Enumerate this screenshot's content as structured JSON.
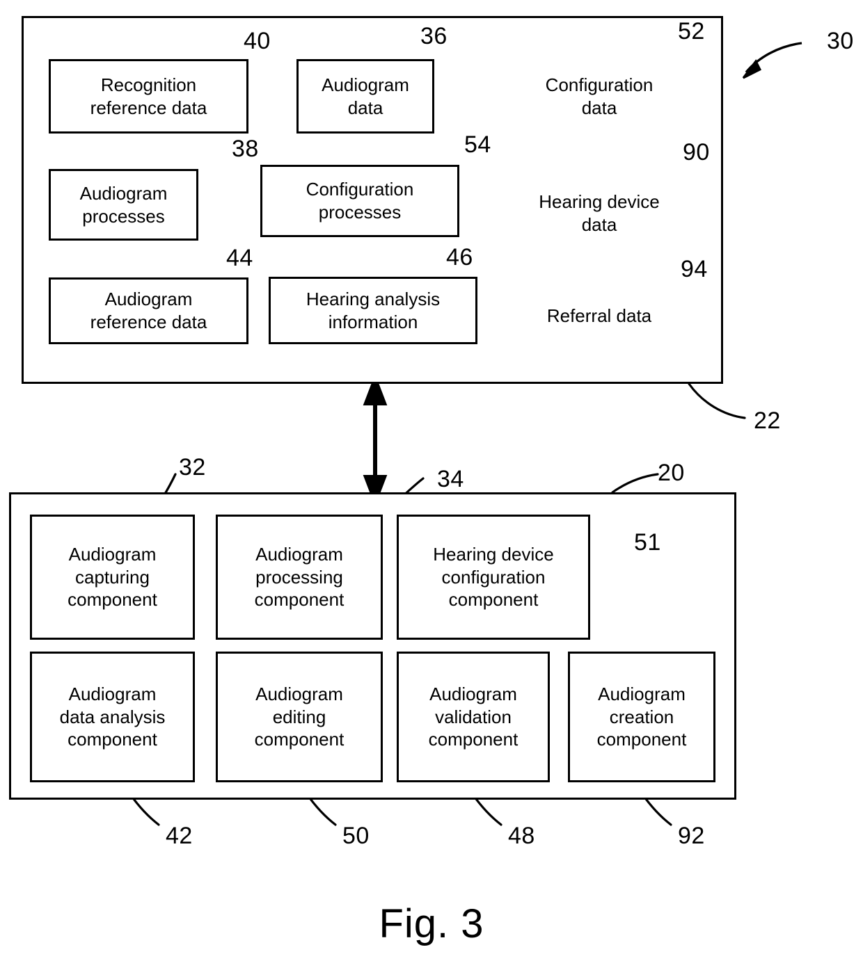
{
  "figure": {
    "caption": "Fig. 3",
    "containers": [
      {
        "id": "box-22",
        "ref": "22",
        "role": "memory-block"
      },
      {
        "id": "box-20",
        "ref": "20",
        "role": "processor-block"
      }
    ],
    "system_ref": "30"
  },
  "memory_block": {
    "ref": "22",
    "boxes": [
      {
        "ref": "40",
        "label": "Recognition\nreference data"
      },
      {
        "ref": "36",
        "label": "Audiogram\ndata"
      },
      {
        "ref": "38",
        "label": "Audiogram\nprocesses"
      },
      {
        "ref": "54",
        "label": "Configuration\nprocesses"
      },
      {
        "ref": "44",
        "label": "Audiogram\nreference data"
      },
      {
        "ref": "46",
        "label": "Hearing analysis\ninformation"
      }
    ],
    "databases": [
      {
        "ref": "52",
        "label": "Configuration\ndata"
      },
      {
        "ref": "90",
        "label": "Hearing device\ndata"
      },
      {
        "ref": "94",
        "label": "Referral data"
      }
    ]
  },
  "component_block": {
    "ref": "20",
    "row1": [
      {
        "ref": "32",
        "label": "Audiogram\ncapturing\ncomponent"
      },
      {
        "ref": "34",
        "label": "Audiogram\nprocessing\ncomponent"
      },
      {
        "ref": "51",
        "label": "Hearing device\nconfiguration\ncomponent"
      }
    ],
    "row2": [
      {
        "ref": "42",
        "label": "Audiogram\ndata analysis\ncomponent"
      },
      {
        "ref": "50",
        "label": "Audiogram\nediting\ncomponent"
      },
      {
        "ref": "48",
        "label": "Audiogram\nvalidation\ncomponent"
      },
      {
        "ref": "92",
        "label": "Audiogram\ncreation\ncomponent"
      }
    ]
  },
  "colors": {
    "stroke": "#000000",
    "fill": "#ffffff"
  }
}
